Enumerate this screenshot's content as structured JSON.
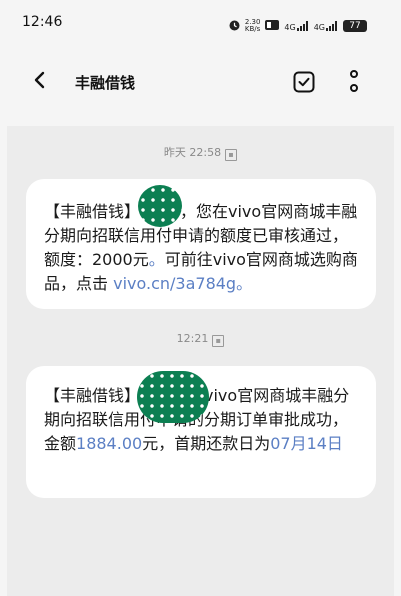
{
  "status_bar": {
    "time": "12:46",
    "speed_value": "2.30",
    "speed_unit": "KB/s",
    "network_1": "4G",
    "network_2": "4G",
    "battery": "77"
  },
  "header": {
    "title": "丰融借钱"
  },
  "messages": [
    {
      "timestamp": "昨天 22:58",
      "segments": [
        {
          "text": "【丰融借钱】"
        },
        {
          "text": "*您好，您在vivo官网商城丰融分期向招联信用付申请的额度已审核通过，额度：2000元"
        },
        {
          "text": "。",
          "link": true
        },
        {
          "text": "可前往vivo官网商城选购商品，点击 "
        },
        {
          "text": "vivo.cn/3a784g。",
          "link": true
        }
      ]
    },
    {
      "timestamp": "12:21",
      "segments": [
        {
          "text": "【丰融借钱】"
        },
        {
          "text": "好，您在vivo官网商城丰融分期向招联信用付申请的分期订单审批成功，金额"
        },
        {
          "text": "1884.00",
          "link": true
        },
        {
          "text": "元，首期还款日为"
        },
        {
          "text": "07月14日",
          "link": true
        }
      ]
    }
  ],
  "icons": {
    "back": "back-arrow-icon",
    "check": "checkbox-icon",
    "more": "more-vertical-icon",
    "message_tag": "sms-tag-icon"
  }
}
